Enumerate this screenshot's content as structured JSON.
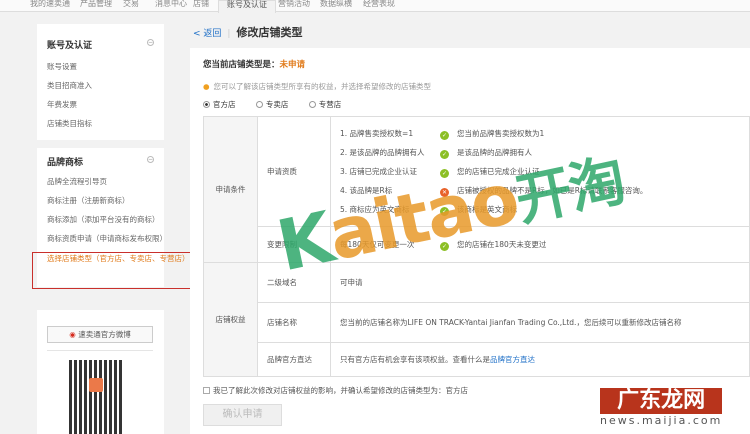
{
  "topnav": [
    "我的速卖通",
    "产品管理",
    "交易",
    "消息中心",
    "店铺",
    "账号及认证",
    "营销活动",
    "数据纵横",
    "经营表现"
  ],
  "sidebar": {
    "group1": {
      "title": "账号及认证",
      "items": [
        "账号设置",
        "类目招商准入",
        "年费发票",
        "店铺类目指标"
      ]
    },
    "group2": {
      "title": "品牌商标",
      "items": [
        "品牌全流程引导页",
        "商标注册（注册新商标）",
        "商标添加（添加平台没有的商标）",
        "商标资质申请（申请商标发布权限）",
        "选择店铺类型（官方店、专卖店、专营店）"
      ]
    },
    "weibo_button": "速卖通官方微博"
  },
  "header": {
    "back": "< 返回",
    "title": "修改店铺类型"
  },
  "main": {
    "current_label": "您当前店铺类型是：",
    "current_value": "未申请",
    "tip": "您可以了解该店铺类型所享有的权益，并选择希望修改的店铺类型",
    "radios": [
      "官方店",
      "专卖店",
      "专营店"
    ],
    "table": {
      "cond_label": "申请条件",
      "qual_label": "申请资质",
      "qual_items": [
        {
          "req": "1. 品牌售卖授权数=1",
          "status": "ok",
          "msg": "您当前品牌售卖授权数为1"
        },
        {
          "req": "2. 是该品牌的品牌拥有人",
          "status": "ok",
          "msg": "是该品牌的品牌拥有人"
        },
        {
          "req": "3. 店铺已完成企业认证",
          "status": "ok",
          "msg": "您的店铺已完成企业认证"
        },
        {
          "req": "4. 该品牌是R标",
          "status": "fail",
          "msg": "店铺被授权的品牌不是R标，如已是R标请联系客服咨询。"
        },
        {
          "req": "5. 商标应为英文商标",
          "status": "ok",
          "msg": "该商标是英文商标"
        }
      ],
      "change_label": "变更限制",
      "change_req": "每180天仅可变更一次",
      "change_msg": "您的店铺在180天未变更过",
      "rights_label": "店铺权益",
      "domain_label": "二级域名",
      "domain_value": "可申请",
      "name_label": "店铺名称",
      "name_value": "您当前的店铺名称为LIFE ON TRACK-Yantai Jianfan Trading Co.,Ltd.，您后续可以重新修改店铺名称",
      "direct_label": "品牌官方直达",
      "direct_value": "只有官方店有机会享有该项权益。查看什么是",
      "direct_link": "品牌官方直达"
    },
    "agree": "我已了解此次修改对店铺权益的影响，并确认希望修改的店铺类型为：官方店",
    "confirm_button": "确认申请"
  },
  "watermarks": {
    "kaitao": "Kaitao开淘",
    "site": "广东龙网",
    "url": "news.maijia.com"
  },
  "colors": {
    "accent": "#e07a1a",
    "link": "#1e6fc7",
    "ok": "#8cbf26",
    "fail": "#e8622a"
  }
}
